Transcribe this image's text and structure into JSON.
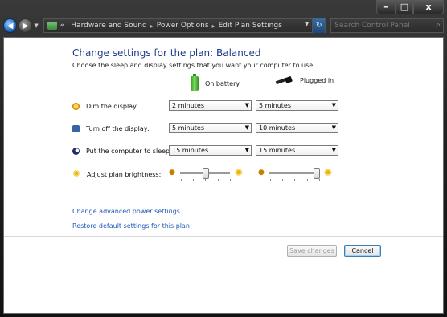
{
  "window": {
    "caption": {
      "minimize": "–",
      "maximize": "□",
      "close": "x"
    }
  },
  "nav": {
    "back_glyph": "◀",
    "forward_glyph": "▶",
    "breadcrumb": {
      "prefix": "«",
      "items": [
        "Hardware and Sound",
        "Power Options",
        "Edit Plan Settings"
      ]
    },
    "search": {
      "placeholder": "Search Control Panel"
    }
  },
  "page": {
    "title": "Change settings for the plan: Balanced",
    "subtitle": "Choose the sleep and display settings that you want your computer to use.",
    "columns": {
      "battery": "On battery",
      "plugged": "Plugged in"
    },
    "rows": [
      {
        "label": "Dim the display:",
        "icon": "dim-display-icon",
        "battery": "2 minutes",
        "plugged": "5 minutes"
      },
      {
        "label": "Turn off the display:",
        "icon": "monitor-icon",
        "battery": "5 minutes",
        "plugged": "10 minutes"
      },
      {
        "label": "Put the computer to sleep:",
        "icon": "sleep-moon-icon",
        "battery": "15 minutes",
        "plugged": "15 minutes"
      }
    ],
    "brightness": {
      "label": "Adjust plan brightness:",
      "battery_level": 0.5,
      "plugged_level": 1.0
    },
    "links": {
      "advanced": "Change advanced power settings",
      "restore": "Restore default settings for this plan"
    },
    "buttons": {
      "save": "Save changes",
      "cancel": "Cancel"
    }
  }
}
